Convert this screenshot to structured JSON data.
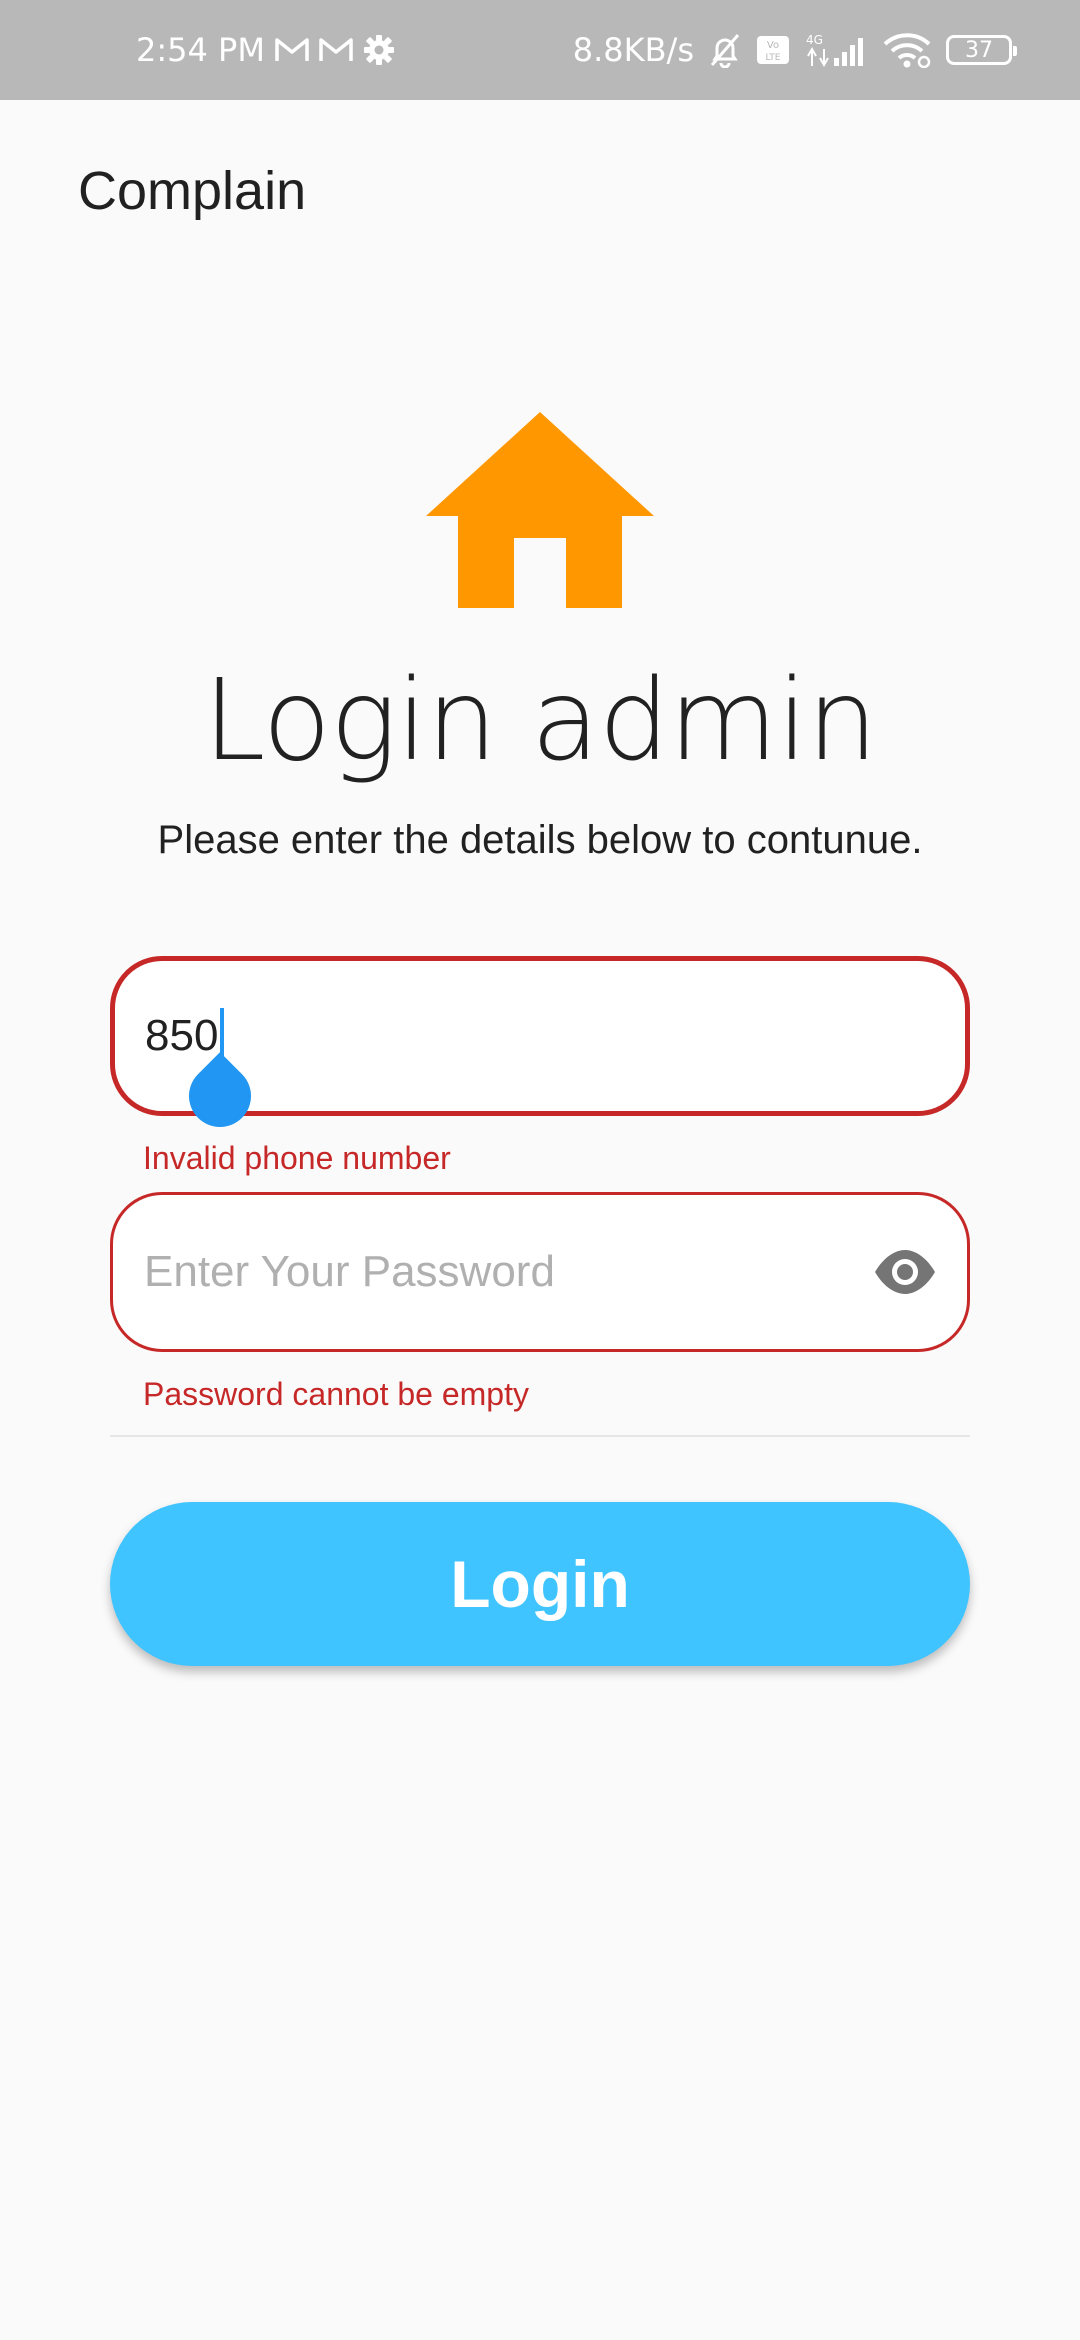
{
  "status_bar": {
    "time": "2:54 PM",
    "network_speed": "8.8KB/s",
    "battery_level": "37",
    "icons": [
      "gmail-icon",
      "gmail-icon",
      "settings-icon",
      "mute-bell-icon",
      "volte-icon",
      "signal-4g-icon",
      "wifi-icon",
      "battery-icon"
    ]
  },
  "app_bar": {
    "title": "Complain"
  },
  "logo": {
    "icon": "home-icon",
    "color": "#ff9800"
  },
  "heading": "Login admin",
  "subheading": "Please enter the details below to contunue.",
  "phone_field": {
    "value": "850",
    "error": "Invalid phone number"
  },
  "password_field": {
    "placeholder": "Enter Your Password",
    "value": "",
    "error": "Password cannot be empty",
    "toggle_icon": "eye-icon"
  },
  "login_button": {
    "label": "Login",
    "color": "#40c4ff"
  },
  "colors": {
    "error": "#c62828",
    "caret": "#2196f3",
    "background": "#fafafa"
  }
}
